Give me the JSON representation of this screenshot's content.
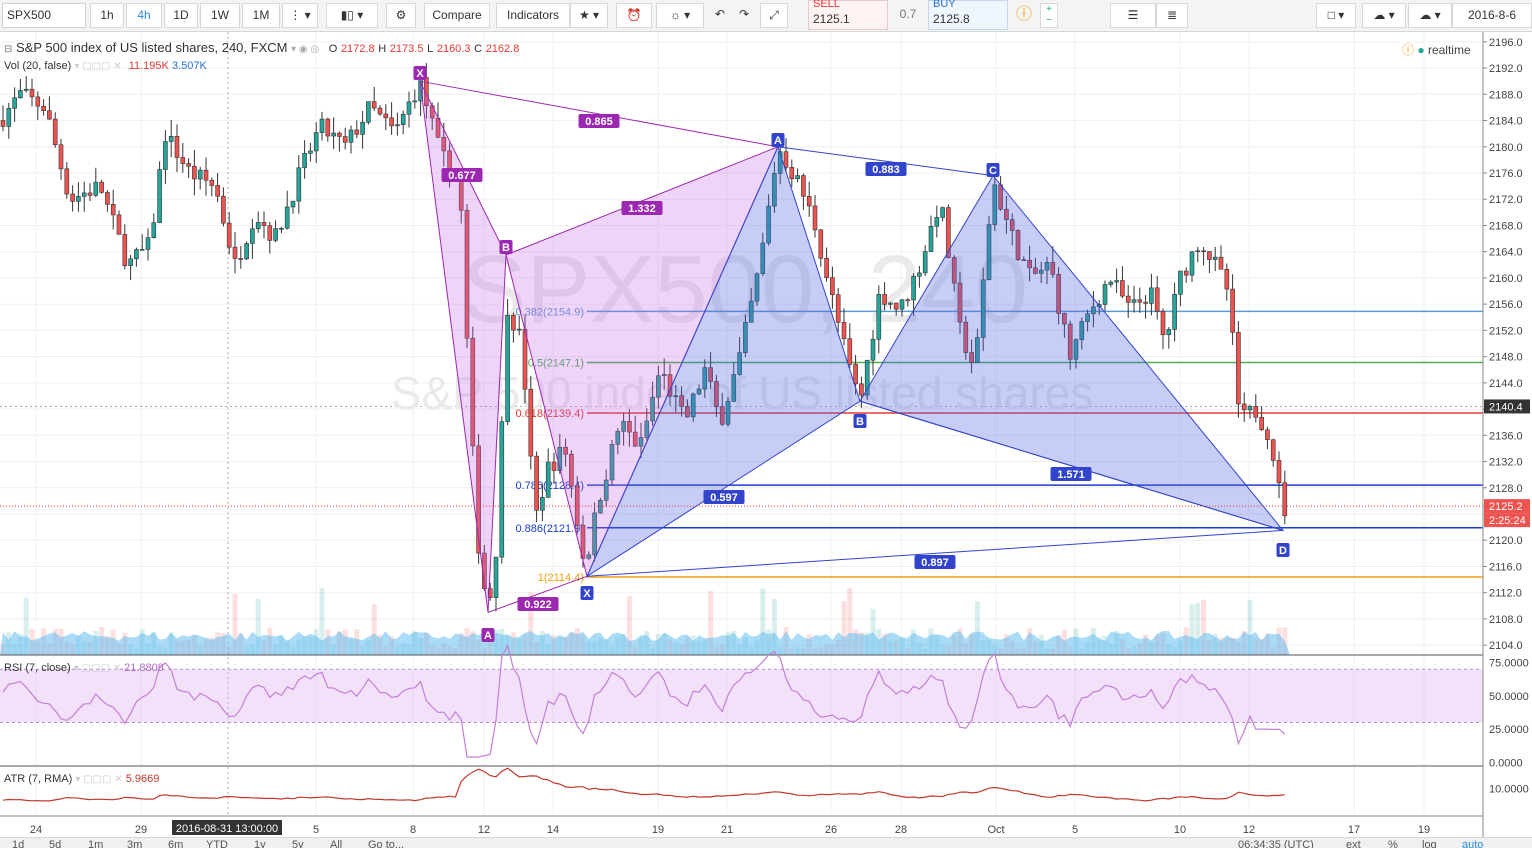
{
  "toolbar": {
    "symbol": "SPX500",
    "intervals": [
      "1h",
      "4h",
      "1D",
      "1W",
      "1M"
    ],
    "selected_interval": "4h",
    "compare_label": "Compare",
    "indicators_label": "Indicators",
    "sell_label": "SELL",
    "sell_price": "2125.1",
    "spread": "0.7",
    "buy_label": "BUY",
    "buy_price": "2125.8",
    "date": "2016-8-6"
  },
  "legend": {
    "title": "S&P 500 index of US listed shares, 240, FXCM",
    "open_label": "O",
    "open": "2172.8",
    "high_label": "H",
    "high": "2173.5",
    "low_label": "L",
    "low": "2160.3",
    "close_label": "C",
    "close": "2162.8",
    "vol_label": "Vol (20, false)",
    "vol1": "11.195K",
    "vol2": "3.507K",
    "realtime": "realtime"
  },
  "watermark": {
    "symbol": "SPX500, 240",
    "name": "S&P 500 index of US listed shares"
  },
  "price_axis": {
    "ticks": [
      "2196.0",
      "2192.0",
      "2188.0",
      "2184.0",
      "2180.0",
      "2176.0",
      "2172.0",
      "2168.0",
      "2164.0",
      "2160.0",
      "2156.0",
      "2152.0",
      "2148.0",
      "2144.0",
      "2140.0",
      "2136.0",
      "2132.0",
      "2128.0",
      "2124.0",
      "2120.0",
      "2116.0",
      "2112.0",
      "2108.0",
      "2104.0"
    ],
    "crosshair_label": "2140.4",
    "last_price_label": "2125.2",
    "countdown_label": "2:25:24"
  },
  "time_axis": {
    "labels": [
      "24",
      "29",
      "5",
      "8",
      "12",
      "14",
      "19",
      "21",
      "26",
      "28",
      "Oct",
      "5",
      "10",
      "12",
      "17",
      "19"
    ],
    "crosshair_label": "2016-08-31 13:00:00"
  },
  "fib_levels": [
    {
      "label": "0.382(2154.9)",
      "price": 2154.9,
      "color": "#5b9bd5"
    },
    {
      "label": "0.5(2147.1)",
      "price": 2147.1,
      "color": "#4caf50"
    },
    {
      "label": "0.618(2139.4)",
      "price": 2139.4,
      "color": "#e53935"
    },
    {
      "label": "0.786(2128.4)",
      "price": 2128.4,
      "color": "#1a3ccc"
    },
    {
      "label": "0.886(2121.9)",
      "price": 2121.9,
      "color": "#1a3ccc"
    },
    {
      "label": "1(2114.4)",
      "price": 2114.4,
      "color": "#f39c12"
    }
  ],
  "pattern_purple": {
    "points": [
      "X",
      "A",
      "B",
      "C",
      "D"
    ],
    "ratios": [
      "0.865",
      "0.677",
      "1.332",
      "0.922"
    ]
  },
  "pattern_blue": {
    "points": [
      "X",
      "A",
      "B",
      "C",
      "D"
    ],
    "ratios": [
      "0.883",
      "0.597",
      "1.571",
      "0.897"
    ]
  },
  "rsi": {
    "label": "RSI (7, close)",
    "value": "21.8809",
    "ticks": [
      "75.0000",
      "50.0000",
      "25.0000",
      "0.0000"
    ]
  },
  "atr": {
    "label": "ATR (7, RMA)",
    "value": "5.9669",
    "ticks": [
      "10.0000"
    ]
  },
  "bottom_bar": {
    "ranges": [
      "1d",
      "5d",
      "1m",
      "3m",
      "6m",
      "YTD",
      "1y",
      "5y",
      "All",
      "Go to..."
    ],
    "clock": "06:34:35 (UTC)",
    "options": [
      "ext",
      "%",
      "log",
      "auto"
    ]
  },
  "chart_data": {
    "type": "candlestick",
    "title": "S&P 500 index of US listed shares, 240, FXCM",
    "ylim": [
      2102.5,
      2197.5
    ],
    "harmonic_points_purple": {
      "X": 2190.0,
      "A": 2109.0,
      "B": 2163.5,
      "C": 2114.5,
      "D": null
    },
    "harmonic_points_blue": {
      "X": 2114.5,
      "A": 2180.0,
      "B": 2141.2,
      "C": 2175.6,
      "D": 2121.5
    },
    "current_price": 2125.2,
    "rsi_last": 21.8809,
    "atr_last": 5.9669,
    "colors": {
      "up": "#26a69a",
      "down": "#ef5350",
      "purple": "#9c27b0",
      "blue": "#3344cc"
    }
  }
}
